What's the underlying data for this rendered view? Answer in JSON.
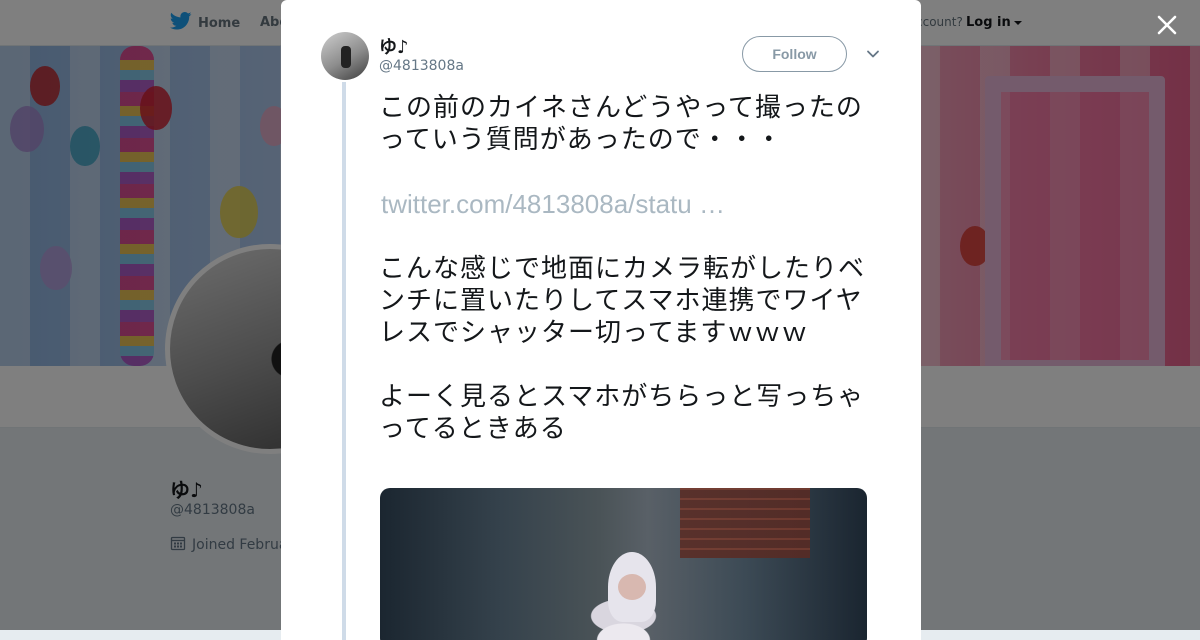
{
  "nav": {
    "home_label": "Home",
    "about_label": "Abo",
    "account_prompt": "ccount?",
    "login_label": "Log in"
  },
  "profile": {
    "name": "ゆ♪",
    "handle": "@4813808a",
    "joined": "Joined Februa"
  },
  "tweet": {
    "author_name": "ゆ♪",
    "author_handle": "@4813808a",
    "follow_label": "Follow",
    "text": {
      "p1": "この前のカイネさんどうやって撮ったのっていう質問があったので・・・",
      "link": "twitter.com/4813808a/statu …",
      "p2": "こんな感じで地面にカメラ転がしたりベンチに置いたりしてスマホ連携でワイヤレスでシャッター切ってますｗｗｗ",
      "p3": "よーく見るとスマホがちらっと写っちゃってるときある"
    }
  },
  "colors": {
    "twitter_blue": "#1da1f2",
    "link_gray": "#aab8c2",
    "overlay": "rgba(0,0,0,0.5)"
  },
  "icons": {
    "nav_home": "twitter-bird-icon",
    "close": "close-icon",
    "caret": "chevron-down-icon",
    "joined": "calendar-icon"
  }
}
